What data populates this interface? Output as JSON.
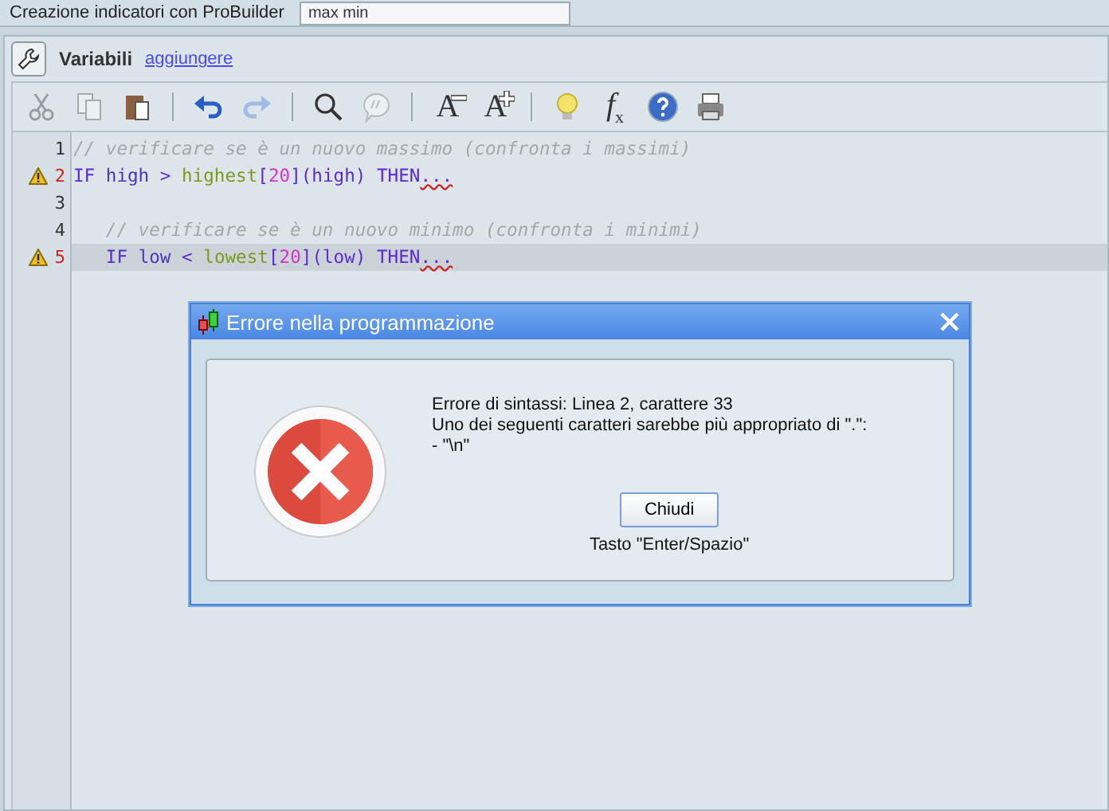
{
  "top_bar": {
    "title": "Creazione indicatori con ProBuilder",
    "name_field": {
      "value": "max min"
    }
  },
  "variables": {
    "label": "Variabili",
    "link": "aggiungere"
  },
  "toolbar": [
    {
      "kind": "cut",
      "disabled": true
    },
    {
      "kind": "copy",
      "disabled": true
    },
    {
      "kind": "paste",
      "disabled": false
    },
    {
      "kind": "separator"
    },
    {
      "kind": "undo",
      "disabled": false
    },
    {
      "kind": "redo",
      "disabled": true
    },
    {
      "kind": "separator"
    },
    {
      "kind": "search",
      "disabled": false
    },
    {
      "kind": "comment",
      "disabled": true
    },
    {
      "kind": "separator"
    },
    {
      "kind": "font-smaller",
      "label": "A",
      "disabled": false
    },
    {
      "kind": "font-larger",
      "label": "A",
      "disabled": false
    },
    {
      "kind": "separator"
    },
    {
      "kind": "bulb",
      "disabled": false
    },
    {
      "kind": "function",
      "label": "f",
      "sub": "x",
      "disabled": false
    },
    {
      "kind": "help",
      "disabled": false
    },
    {
      "kind": "print",
      "disabled": false
    }
  ],
  "code_lines": [
    {
      "number": "1",
      "warning": false,
      "current": false,
      "tokens": [
        {
          "kind": "comment",
          "text": "// verificare se è un nuovo massimo (confronta i massimi)"
        }
      ]
    },
    {
      "number": "2",
      "warning": true,
      "current": false,
      "tokens": [
        {
          "kind": "keyword",
          "text": "IF "
        },
        {
          "kind": "ident",
          "text": "high "
        },
        {
          "kind": "keyword",
          "text": "> "
        },
        {
          "kind": "function",
          "text": "highest"
        },
        {
          "kind": "keyword",
          "text": "["
        },
        {
          "kind": "number",
          "text": "20"
        },
        {
          "kind": "keyword",
          "text": "]"
        },
        {
          "kind": "keyword",
          "text": "(high) "
        },
        {
          "kind": "keyword",
          "text": "THEN"
        },
        {
          "kind": "error",
          "text": "..."
        }
      ]
    },
    {
      "number": "3",
      "warning": false,
      "current": false
    },
    {
      "number": "4",
      "warning": false,
      "current": false,
      "tokens": [
        {
          "kind": "comment",
          "text": "   // verificare se è un nuovo minimo (confronta i minimi)"
        }
      ]
    },
    {
      "number": "5",
      "warning": true,
      "current": true,
      "tokens": [
        {
          "kind": "keyword",
          "text": "   IF "
        },
        {
          "kind": "ident",
          "text": "low "
        },
        {
          "kind": "keyword",
          "text": "< "
        },
        {
          "kind": "function",
          "text": "lowest"
        },
        {
          "kind": "keyword",
          "text": "["
        },
        {
          "kind": "number",
          "text": "20"
        },
        {
          "kind": "keyword",
          "text": "]"
        },
        {
          "kind": "keyword",
          "text": "(low) "
        },
        {
          "kind": "keyword",
          "text": "THEN"
        },
        {
          "kind": "error",
          "text": "..."
        }
      ]
    }
  ],
  "dialog": {
    "title": "Errore nella programmazione",
    "message_lines": [
      "Errore di sintassi: Linea 2, carattere 33",
      "Uno dei seguenti caratteri sarebbe più appropriato di \".\":",
      "- \"\\n\""
    ],
    "button": "Chiudi",
    "hint": "Tasto \"Enter/Spazio\""
  }
}
